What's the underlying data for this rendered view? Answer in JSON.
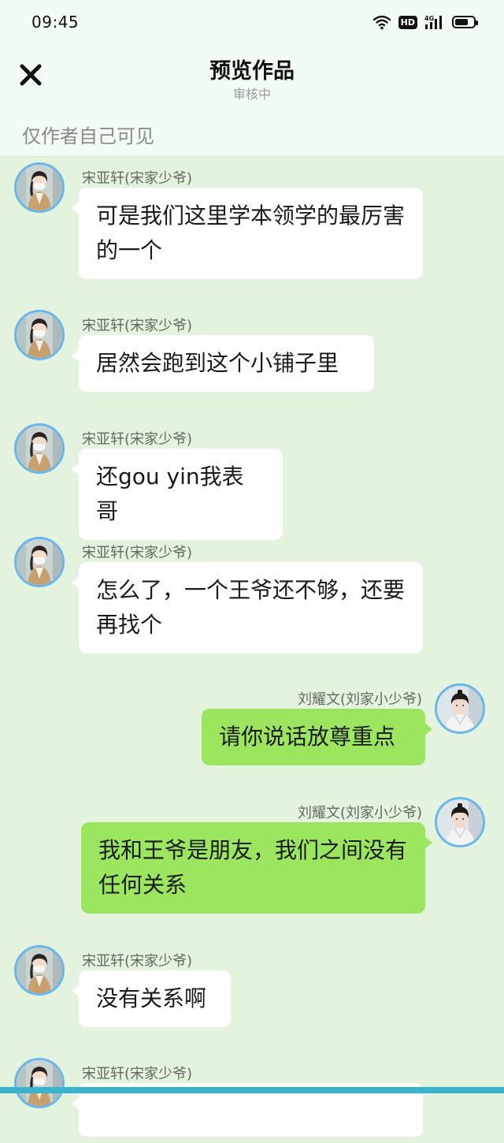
{
  "status_bar": {
    "time": "09:45",
    "hd": "HD",
    "network": "4G",
    "battery_fraction": 0.75
  },
  "header": {
    "title": "预览作品",
    "subtitle": "审核中",
    "close_icon": "close-icon"
  },
  "notice": "仅作者自己可见",
  "colors": {
    "background": "#e4f3de",
    "header_bg": "#f1fcf4",
    "left_bubble": "#ffffff",
    "right_bubble": "#9ce55e",
    "avatar_ring": "#6ab6ec",
    "bottom_bar": "#3ab3cf"
  },
  "messages": [
    {
      "side": "left",
      "sender": "宋亚轩(宋家少爷)",
      "text": "可是我们这里学本领学的最厉害的一个"
    },
    {
      "side": "left",
      "sender": "宋亚轩(宋家少爷)",
      "text": "居然会跑到这个小铺子里"
    },
    {
      "side": "left",
      "sender": "宋亚轩(宋家少爷)",
      "text": "还gou yin我表哥"
    },
    {
      "side": "left",
      "sender": "宋亚轩(宋家少爷)",
      "text": "怎么了，一个王爷还不够，还要再找个"
    },
    {
      "side": "right",
      "sender": "刘耀文(刘家小少爷)",
      "text": "请你说话放尊重点"
    },
    {
      "side": "right",
      "sender": "刘耀文(刘家小少爷)",
      "text": "我和王爷是朋友，我们之间没有任何关系"
    },
    {
      "side": "left",
      "sender": "宋亚轩(宋家少爷)",
      "text": "没有关系啊"
    },
    {
      "side": "left",
      "sender": "宋亚轩(宋家少爷)",
      "text": ""
    }
  ]
}
